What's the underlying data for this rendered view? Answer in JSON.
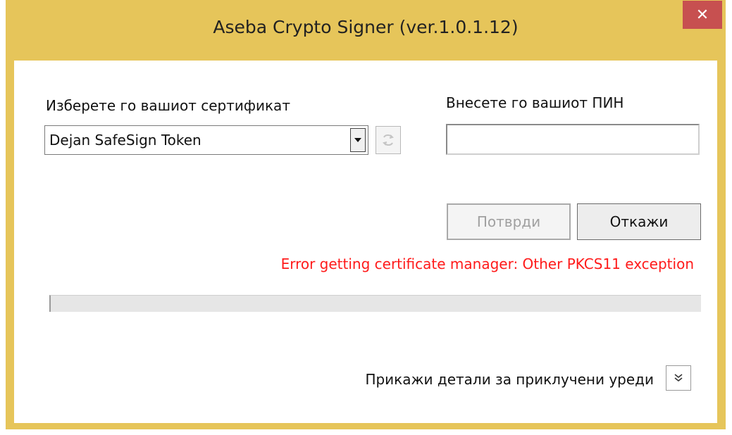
{
  "window": {
    "title": "Aseba Crypto Signer (ver.1.0.1.12)",
    "close_glyph": "✕",
    "title_bar_color": "#e6c55a",
    "close_button_color": "#c75050"
  },
  "certificate": {
    "label": "Изберете го вашиот сертификат",
    "selected_value": "Dejan SafeSign Token"
  },
  "pin": {
    "label": "Внесете го вашиот ПИН",
    "value": ""
  },
  "buttons": {
    "confirm_label": "Потврди",
    "cancel_label": "Откажи"
  },
  "status": {
    "error_message": "Error getting certificate manager: Other PKCS11 exception",
    "error_color": "#ff1a1a"
  },
  "progress": {
    "fraction": 0
  },
  "details": {
    "label": "Прикажи детали за приклучени уреди"
  },
  "icons": {
    "dropdown": "chevron-down-icon",
    "refresh": "refresh-icon",
    "expand": "double-chevron-down-icon",
    "close": "close-icon"
  }
}
